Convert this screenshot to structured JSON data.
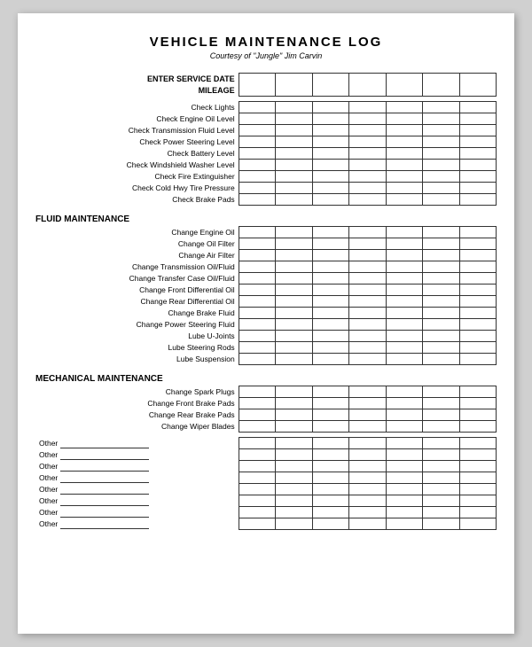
{
  "title": "VEHICLE MAINTENANCE LOG",
  "subtitle": "Courtesy of \"Jungle\" Jim Carvin",
  "sections": {
    "header": {
      "service_date": "ENTER SERVICE DATE",
      "mileage": "MILEAGE"
    },
    "inspection": {
      "title": null,
      "items": [
        "Check Lights",
        "Check Engine Oil Level",
        "Check Transmission Fluid Level",
        "Check Power Steering Level",
        "Check Battery Level",
        "Check Windshield Washer Level",
        "Check Fire Extinguisher",
        "Check Cold Hwy Tire Pressure",
        "Check Brake Pads"
      ]
    },
    "fluid": {
      "title": "FLUID MAINTENANCE",
      "items": [
        "Change Engine Oil",
        "Change Oil Filter",
        "Change Air Filter",
        "Change Transmission Oil/Fluid",
        "Change Transfer Case Oil/Fluid",
        "Change Front Differential Oil",
        "Change Rear Differential Oil",
        "Change Brake Fluid",
        "Change Power Steering Fluid",
        "Lube U-Joints",
        "Lube Steering Rods",
        "Lube Suspension"
      ]
    },
    "mechanical": {
      "title": "MECHANICAL MAINTENANCE",
      "items": [
        "Change Spark Plugs",
        "Change Front Brake Pads",
        "Change Rear Brake Pads",
        "Change Wiper Blades"
      ]
    },
    "other": {
      "label": "Other",
      "count": 8
    }
  },
  "columns": 7
}
